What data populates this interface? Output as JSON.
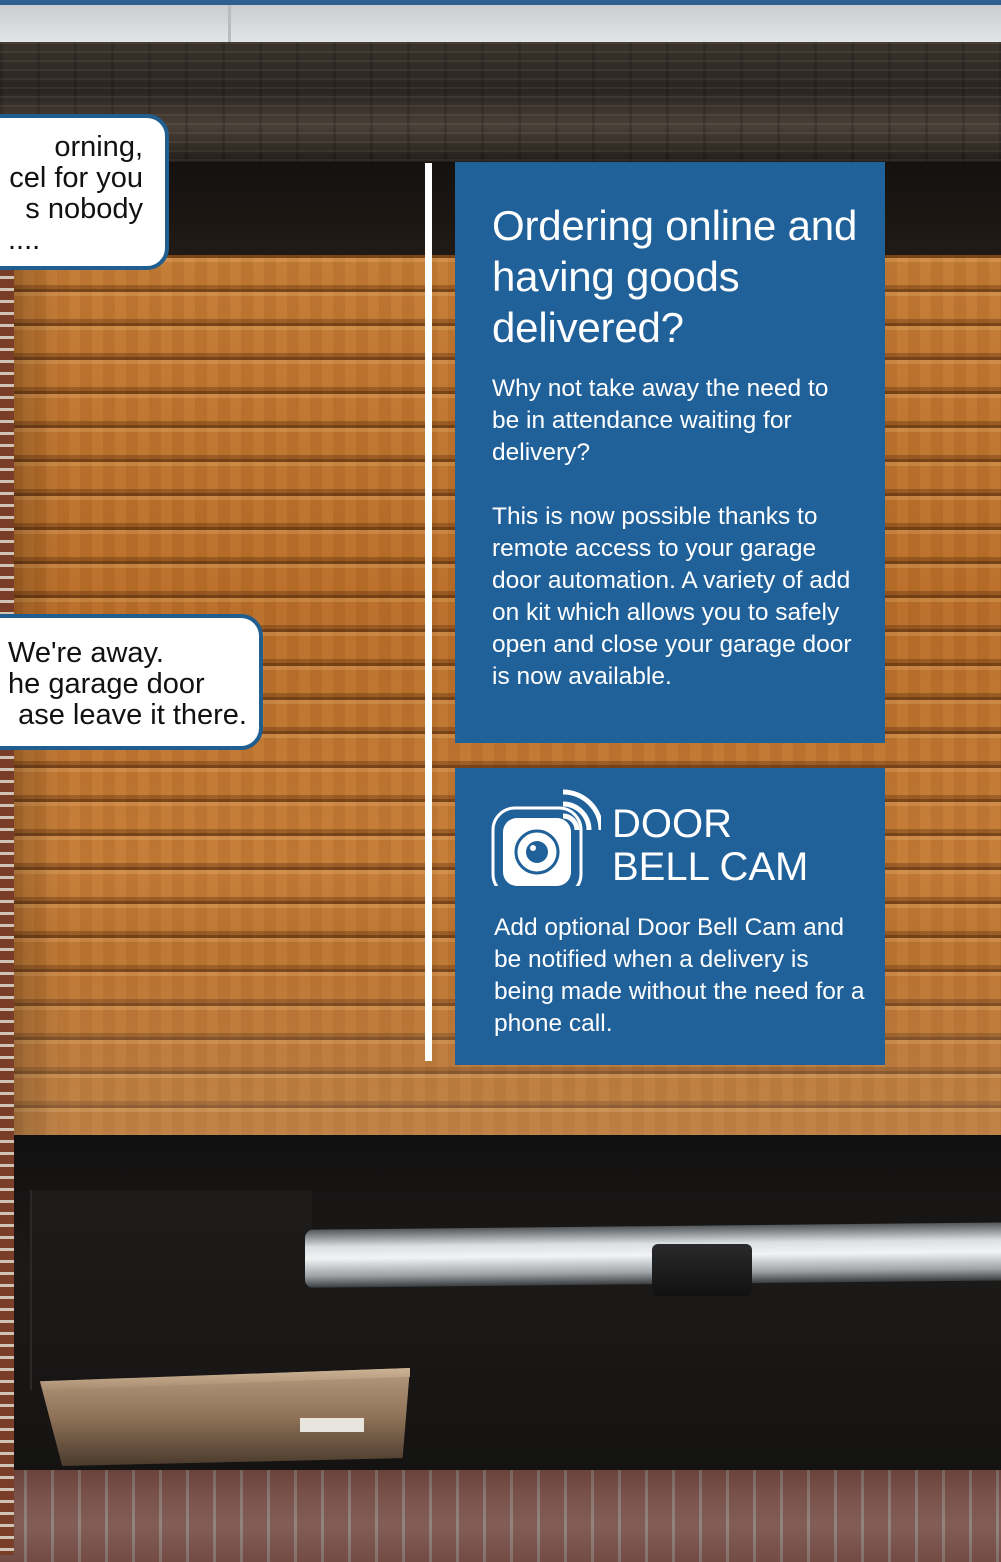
{
  "bubble_top": {
    "lines": [
      "orning,",
      "cel for you",
      "s nobody",
      "...."
    ]
  },
  "bubble_bottom": {
    "lines": [
      "We're away.",
      "he garage door",
      "ase leave it there."
    ]
  },
  "info_panel": {
    "heading_lines": [
      "Ordering online and",
      "having goods",
      "delivered?"
    ],
    "paragraph_1": "Why not take away the need to be in attendance waiting for delivery?",
    "paragraph_2": "This is now possible thanks to remote access to your garage door automation. A variety of add on kit which allows you to safely open and close your garage door is now available."
  },
  "doorbell_panel": {
    "icon": "doorbell-camera-wifi-icon",
    "title_line_1": "DOOR",
    "title_line_2": "BELL CAM",
    "text": "Add optional Door Bell Cam and be notified when a delivery is being made without the need for a phone call."
  },
  "colors": {
    "panel_blue": "#21619a",
    "bubble_border": "#1f5e8e",
    "text_white": "#ffffff"
  }
}
